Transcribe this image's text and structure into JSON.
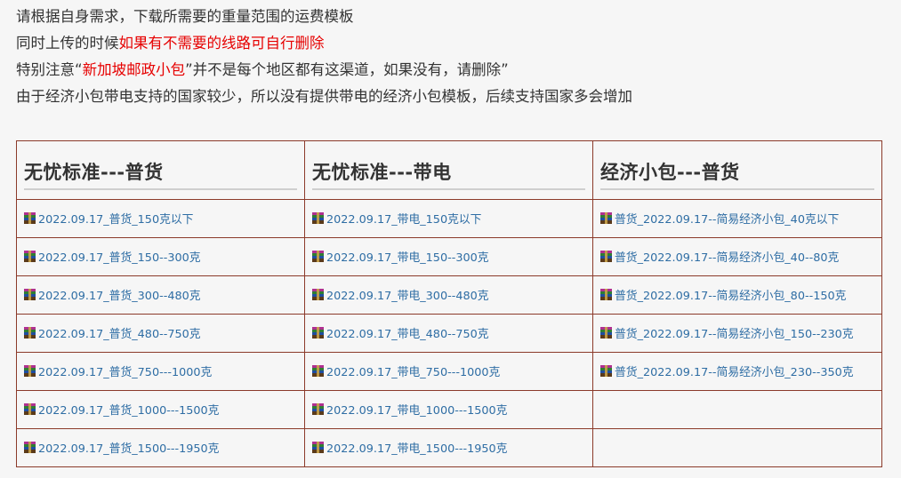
{
  "intro": {
    "line1": "请根据自身需求，下载所需要的重量范围的运费模板",
    "line2_prefix": "同时上传的时候",
    "line2_red": "如果有不需要的线路可自行删除",
    "line3_prefix": "特别注意“",
    "line3_red": "新加坡邮政小包",
    "line3_suffix": "”并不是每个地区都有这渠道，如果没有，请删除”",
    "line4": "由于经济小包带电支持的国家较少，所以没有提供带电的经济小包模板，后续支持国家多会增加"
  },
  "colors": {
    "accent_red": "#e60000",
    "link": "#2e6da4",
    "border": "#8b3a2a"
  },
  "icon": "rar-archive-icon",
  "table": {
    "headers": [
      "无忧标准---普货",
      "无忧标准---带电",
      "经济小包---普货"
    ],
    "rows": [
      [
        "2022.09.17_普货_150克以下",
        "2022.09.17_带电_150克以下",
        "普货_2022.09.17--简易经济小包_40克以下"
      ],
      [
        "2022.09.17_普货_150--300克",
        "2022.09.17_带电_150--300克",
        "普货_2022.09.17--简易经济小包_40--80克"
      ],
      [
        "2022.09.17_普货_300--480克",
        "2022.09.17_带电_300--480克",
        "普货_2022.09.17--简易经济小包_80--150克"
      ],
      [
        "2022.09.17_普货_480--750克",
        "2022.09.17_带电_480--750克",
        "普货_2022.09.17--简易经济小包_150--230克"
      ],
      [
        "2022.09.17_普货_750---1000克",
        "2022.09.17_带电_750---1000克",
        "普货_2022.09.17--简易经济小包_230--350克"
      ],
      [
        "2022.09.17_普货_1000---1500克",
        "2022.09.17_带电_1000---1500克",
        ""
      ],
      [
        "2022.09.17_普货_1500---1950克",
        "2022.09.17_带电_1500---1950克",
        ""
      ]
    ]
  }
}
